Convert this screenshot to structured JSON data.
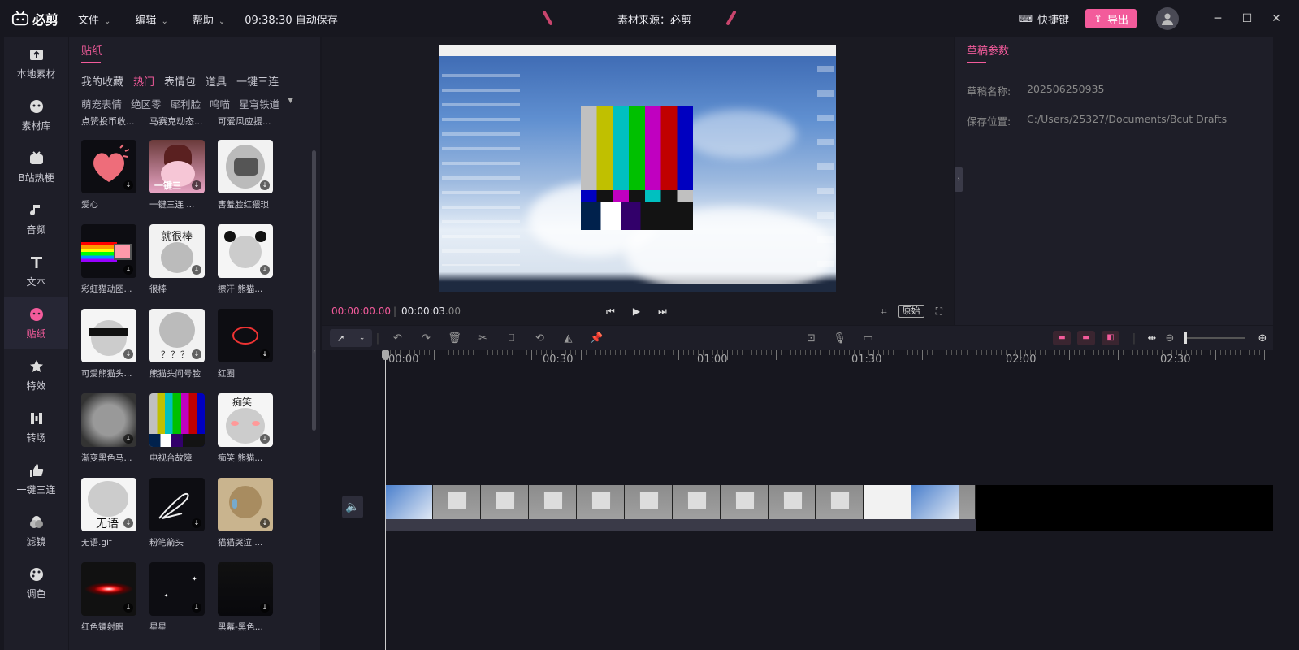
{
  "header": {
    "app_name": "必剪",
    "menus": [
      {
        "label": "文件"
      },
      {
        "label": "编辑"
      },
      {
        "label": "帮助"
      }
    ],
    "autosave": "09:38:30 自动保存",
    "source": "素材来源：必剪",
    "shortcut": "快捷键",
    "export": "导出"
  },
  "nav": [
    {
      "label": "本地素材"
    },
    {
      "label": "素材库"
    },
    {
      "label": "B站热梗"
    },
    {
      "label": "音频"
    },
    {
      "label": "文本"
    },
    {
      "label": "贴纸"
    },
    {
      "label": "特效"
    },
    {
      "label": "转场"
    },
    {
      "label": "一键三连"
    },
    {
      "label": "滤镜"
    },
    {
      "label": "调色"
    }
  ],
  "stickers": {
    "title": "贴纸",
    "categories": [
      "我的收藏",
      "热门",
      "表情包",
      "道具",
      "一键三连"
    ],
    "subcategories": [
      "萌宠表情",
      "绝区零",
      "犀利脸",
      "呜喵",
      "星穹铁道"
    ],
    "partial_items": [
      "点赞投币收...",
      "马赛克动态...",
      "可爱风应援..."
    ],
    "items": [
      {
        "label": "爱心"
      },
      {
        "label": "一键三连 ..."
      },
      {
        "label": "害羞脸红猥琐"
      },
      {
        "label": "彩虹猫动图..."
      },
      {
        "label": "很棒"
      },
      {
        "label": "擦汗 熊猫..."
      },
      {
        "label": "可爱熊猫头..."
      },
      {
        "label": "熊猫头问号脸"
      },
      {
        "label": "红圈"
      },
      {
        "label": "渐变黑色马..."
      },
      {
        "label": "电视台故障"
      },
      {
        "label": "痴笑 熊猫..."
      },
      {
        "label": "无语.gif"
      },
      {
        "label": "粉笔箭头"
      },
      {
        "label": "猫猫哭泣 ..."
      },
      {
        "label": "红色镭射眼"
      },
      {
        "label": "星星"
      },
      {
        "label": "黑幕-黑色..."
      }
    ],
    "thumb_texts": {
      "y2": "一键三",
      "panda_great": "就很棒",
      "panda_q": "？？？",
      "panda_laugh": "痴笑",
      "wuyu": "无语"
    }
  },
  "preview": {
    "current_time": "00:00:00.00",
    "total_time_main": "00:00:03",
    "total_time_frac": ".00",
    "original_label": "原始"
  },
  "params": {
    "title": "草稿参数",
    "name_label": "草稿名称:",
    "name_value": "202506250935",
    "path_label": "保存位置:",
    "path_value": "C:/Users/25327/Documents/Bcut Drafts"
  },
  "timeline": {
    "ruler": [
      "00:00",
      "00:30",
      "01:00",
      "01:30",
      "02:00",
      "02:30"
    ]
  },
  "colors": {
    "accent": "#f35b9b",
    "bg": "#17171f",
    "panel": "#1e1e28"
  }
}
